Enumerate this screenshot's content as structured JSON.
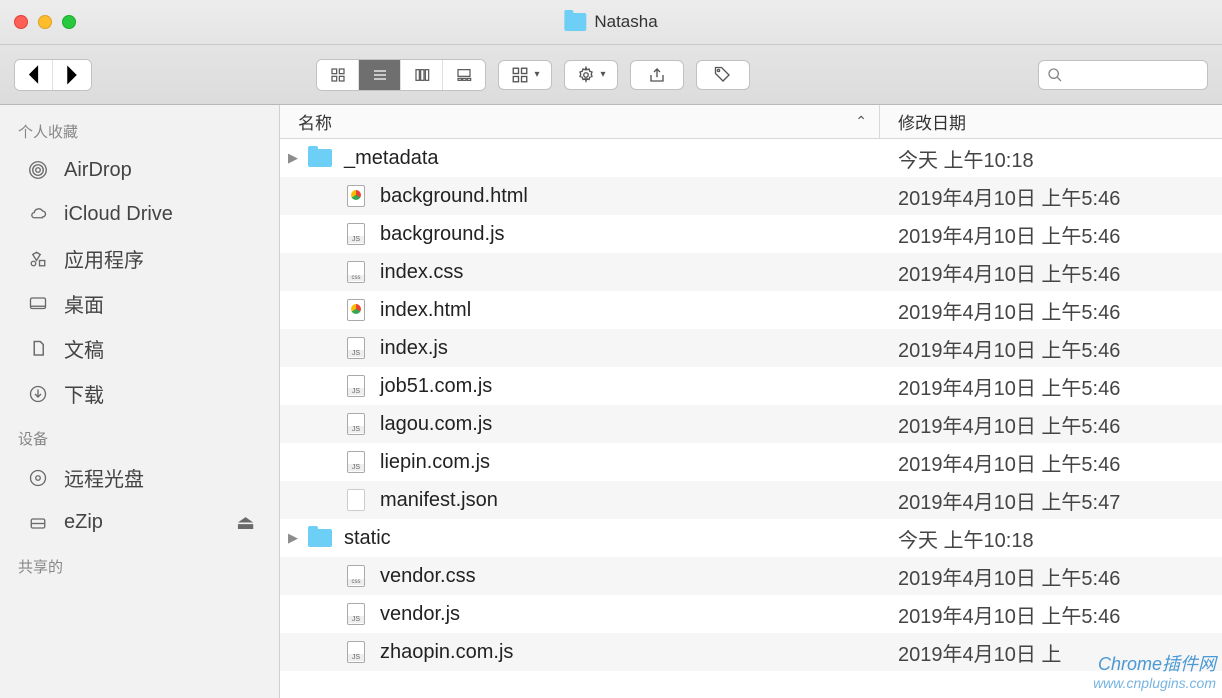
{
  "window": {
    "title": "Natasha"
  },
  "sidebar": {
    "sections": [
      {
        "label": "个人收藏",
        "items": [
          {
            "icon": "airdrop",
            "label": "AirDrop"
          },
          {
            "icon": "icloud",
            "label": "iCloud Drive"
          },
          {
            "icon": "apps",
            "label": "应用程序"
          },
          {
            "icon": "desktop",
            "label": "桌面"
          },
          {
            "icon": "documents",
            "label": "文稿"
          },
          {
            "icon": "downloads",
            "label": "下载"
          }
        ]
      },
      {
        "label": "设备",
        "items": [
          {
            "icon": "disc",
            "label": "远程光盘"
          },
          {
            "icon": "drive",
            "label": "eZip",
            "eject": true
          }
        ]
      },
      {
        "label": "共享的",
        "items": []
      }
    ]
  },
  "columns": {
    "name": "名称",
    "date": "修改日期"
  },
  "files": [
    {
      "type": "folder",
      "name": "_metadata",
      "date": "今天 上午10:18",
      "expandable": true
    },
    {
      "type": "chrome",
      "name": "background.html",
      "date": "2019年4月10日 上午5:46"
    },
    {
      "type": "js",
      "name": "background.js",
      "date": "2019年4月10日 上午5:46"
    },
    {
      "type": "css",
      "name": "index.css",
      "date": "2019年4月10日 上午5:46"
    },
    {
      "type": "chrome",
      "name": "index.html",
      "date": "2019年4月10日 上午5:46"
    },
    {
      "type": "js",
      "name": "index.js",
      "date": "2019年4月10日 上午5:46"
    },
    {
      "type": "js",
      "name": "job51.com.js",
      "date": "2019年4月10日 上午5:46"
    },
    {
      "type": "js",
      "name": "lagou.com.js",
      "date": "2019年4月10日 上午5:46"
    },
    {
      "type": "js",
      "name": "liepin.com.js",
      "date": "2019年4月10日 上午5:46"
    },
    {
      "type": "blank",
      "name": "manifest.json",
      "date": "2019年4月10日 上午5:47"
    },
    {
      "type": "folder",
      "name": "static",
      "date": "今天 上午10:18",
      "expandable": true
    },
    {
      "type": "css",
      "name": "vendor.css",
      "date": "2019年4月10日 上午5:46"
    },
    {
      "type": "js",
      "name": "vendor.js",
      "date": "2019年4月10日 上午5:46"
    },
    {
      "type": "js",
      "name": "zhaopin.com.js",
      "date": "2019年4月10日 上"
    }
  ],
  "watermark": {
    "line1": "Chrome插件网",
    "line2": "www.cnplugins.com"
  }
}
